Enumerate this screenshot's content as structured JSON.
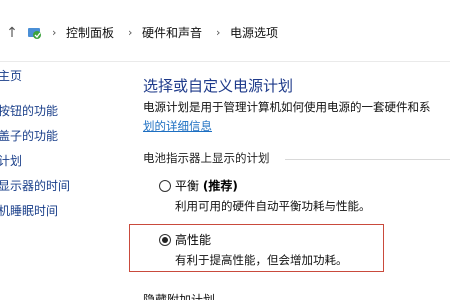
{
  "address": {
    "crumbs": [
      "控制面板",
      "硬件和声音",
      "电源选项"
    ]
  },
  "sidebar": {
    "items": [
      {
        "label": "主页"
      },
      {
        "label": "按钮的功能"
      },
      {
        "label": "盖子的功能"
      },
      {
        "label": "计划"
      },
      {
        "label": "显示器的时间"
      },
      {
        "label": "机睡眠时间"
      }
    ]
  },
  "main": {
    "title": "选择或自定义电源计划",
    "description": "电源计划是用于管理计算机如何使用电源的一套硬件和系",
    "description_link": "划的详细信息",
    "section_label": "电池指示器上显示的计划",
    "plans": [
      {
        "name": "平衡",
        "recommended": "(推荐)",
        "description": "利用可用的硬件自动平衡功耗与性能。",
        "selected": false
      },
      {
        "name": "高性能",
        "recommended": "",
        "description": "有利于提高性能，但会增加功耗。",
        "selected": true
      }
    ],
    "next_section": "隐藏附加计划"
  },
  "colors": {
    "link": "#1d6fc2",
    "title": "#1e3a8a",
    "highlight": "#c94a3c"
  }
}
